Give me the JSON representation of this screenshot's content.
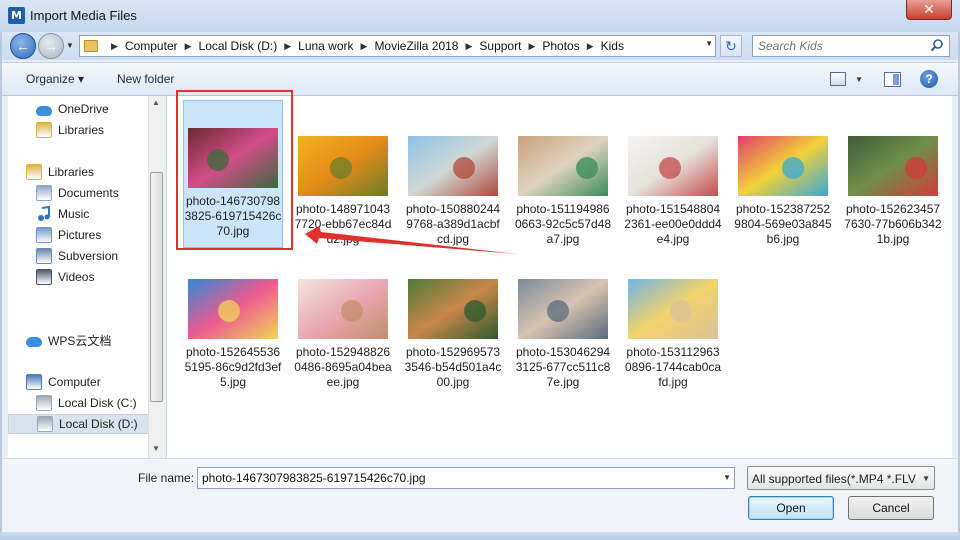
{
  "window": {
    "title": "Import Media Files",
    "app_icon_letter": "M",
    "close_glyph": "✕"
  },
  "address": {
    "crumbs": [
      "Computer",
      "Local Disk (D:)",
      "Luna work",
      "MovieZilla 2018",
      "Support",
      "Photos",
      "Kids"
    ],
    "search_placeholder": "Search Kids"
  },
  "toolbar": {
    "organize_label": "Organize ▾",
    "new_folder_label": "New folder",
    "help_glyph": "?"
  },
  "nav": {
    "items": [
      {
        "label": "OneDrive",
        "icon": "cloud-icon"
      },
      {
        "label": "Libraries",
        "icon": "libraries-icon"
      },
      {
        "label": "Libraries",
        "icon": "libraries-icon"
      },
      {
        "label": "Documents",
        "icon": "documents-icon"
      },
      {
        "label": "Music",
        "icon": "music-icon"
      },
      {
        "label": "Pictures",
        "icon": "pictures-icon"
      },
      {
        "label": "Subversion",
        "icon": "subversion-icon"
      },
      {
        "label": "Videos",
        "icon": "videos-icon"
      },
      {
        "label": "WPS云文档",
        "icon": "cloud-icon"
      },
      {
        "label": "Computer",
        "icon": "computer-icon"
      },
      {
        "label": "Local Disk (C:)",
        "icon": "disk-icon"
      },
      {
        "label": "Local Disk (D:)",
        "icon": "disk-icon"
      }
    ],
    "selected_index": 11
  },
  "files": [
    {
      "name": "photo-1467307983825-619715426c70.jpg",
      "lines": [
        "photo-146730798",
        "3825-619715426c",
        "70.jpg"
      ],
      "colors": [
        "#6a2a2e",
        "#d24d8a",
        "#3a6a3a"
      ]
    },
    {
      "name": "photo-1489710437720-ebb67ec84dd2.jpg",
      "lines": [
        "photo-148971043",
        "7720-ebb67ec84d",
        "d2.jpg"
      ],
      "colors": [
        "#f2b321",
        "#e58b19",
        "#6b7d2a"
      ]
    },
    {
      "name": "photo-1508802449768-a389d1acbfcd.jpg",
      "lines": [
        "photo-150880244",
        "9768-a389d1acbf",
        "cd.jpg"
      ],
      "colors": [
        "#8ec3e6",
        "#cfd8d6",
        "#b0493a"
      ]
    },
    {
      "name": "photo-1511949860663-92c5c57d48a7.jpg",
      "lines": [
        "photo-151194986",
        "0663-92c5c57d48",
        "a7.jpg"
      ],
      "colors": [
        "#c9a27a",
        "#e0d3c0",
        "#3a8b5a"
      ]
    },
    {
      "name": "photo-1515488042361-ee00e0ddd4e4.jpg",
      "lines": [
        "photo-151548804",
        "2361-ee00e0ddd4",
        "e4.jpg"
      ],
      "colors": [
        "#f4f4f2",
        "#e6e2dc",
        "#c44b4b"
      ]
    },
    {
      "name": "photo-1523872529804-569e03a845b6.jpg",
      "lines": [
        "photo-152387252",
        "9804-569e03a845",
        "b6.jpg"
      ],
      "colors": [
        "#e33d6b",
        "#f2d23a",
        "#39a7d6"
      ]
    },
    {
      "name": "photo-1526234577630-77b606b3421b.jpg",
      "lines": [
        "photo-152623457",
        "7630-77b606b342",
        "1b.jpg"
      ],
      "colors": [
        "#3f5a3a",
        "#6f8f4a",
        "#d23a3a"
      ]
    },
    {
      "name": "photo-1526455365195-86c9d2fd3ef5.jpg",
      "lines": [
        "photo-152645536",
        "5195-86c9d2fd3ef",
        "5.jpg"
      ],
      "colors": [
        "#2f8ad8",
        "#ec5a8e",
        "#f2d65a"
      ]
    },
    {
      "name": "photo-1529488260486-8695a04beaee.jpg",
      "lines": [
        "photo-152948826",
        "0486-8695a04bea",
        "ee.jpg"
      ],
      "colors": [
        "#f1e6dc",
        "#e9a9b4",
        "#c28d6b"
      ]
    },
    {
      "name": "photo-1529695733546-b54d501a4c00.jpg",
      "lines": [
        "photo-152969573",
        "3546-b54d501a4c",
        "00.jpg"
      ],
      "colors": [
        "#4c7a3a",
        "#c9874a",
        "#2e5a2e"
      ]
    },
    {
      "name": "photo-1530462943125-677cc511c87e.jpg",
      "lines": [
        "photo-153046294",
        "3125-677cc511c8",
        "7e.jpg"
      ],
      "colors": [
        "#7a8a9c",
        "#d8c4b0",
        "#5a6b7d"
      ]
    },
    {
      "name": "photo-1531129630896-1744cab0cafd.jpg",
      "lines": [
        "photo-153112963",
        "0896-1744cab0ca",
        "fd.jpg"
      ],
      "colors": [
        "#6fb6e6",
        "#f2d36b",
        "#d9c29a"
      ]
    }
  ],
  "selected_file_index": 0,
  "bottom": {
    "file_name_label": "File name:",
    "file_name_value": "photo-1467307983825-619715426c70.jpg",
    "filter_value": "All supported files(*.MP4 *.FLV",
    "open_label": "Open",
    "cancel_label": "Cancel"
  },
  "colors": {
    "highlight": "#e0302a",
    "arrow": "#e0302a",
    "selection_fill": "#cde5fb"
  }
}
